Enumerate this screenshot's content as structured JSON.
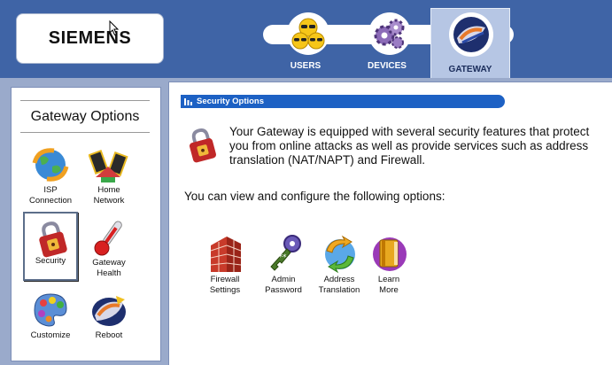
{
  "header": {
    "brand": "SIEMENS",
    "nav": [
      {
        "label": "USERS",
        "icon": "users-icon"
      },
      {
        "label": "DEVICES",
        "icon": "devices-icon"
      },
      {
        "label": "GATEWAY",
        "icon": "gateway-icon",
        "active": true
      }
    ]
  },
  "sidebar": {
    "title": "Gateway Options",
    "items": [
      {
        "label": "ISP\nConnection",
        "icon": "isp-connection-icon"
      },
      {
        "label": "Home\nNetwork",
        "icon": "home-network-icon"
      },
      {
        "label": "Security",
        "icon": "security-lock-icon",
        "selected": true
      },
      {
        "label": "Gateway\nHealth",
        "icon": "thermometer-icon"
      },
      {
        "label": "Customize",
        "icon": "palette-icon"
      },
      {
        "label": "Reboot",
        "icon": "reboot-icon"
      }
    ]
  },
  "main": {
    "section_title": "Security Options",
    "intro": "Your Gateway is equipped with several security features that protect you from online attacks as well as provide services such as address translation (NAT/NAPT) and Firewall.",
    "options_prompt": "You can view and configure the following options:",
    "options": [
      {
        "label": "Firewall\nSettings",
        "icon": "firewall-icon"
      },
      {
        "label": "Admin\nPassword",
        "icon": "key-icon"
      },
      {
        "label": "Address\nTranslation",
        "icon": "address-translation-icon"
      },
      {
        "label": "Learn\nMore",
        "icon": "book-icon"
      }
    ]
  },
  "colors": {
    "header_bg": "#3f64a6",
    "frame_bg": "#9aaacb",
    "section_bar": "#1d61c4",
    "active_tab": "#b6c6e4"
  }
}
